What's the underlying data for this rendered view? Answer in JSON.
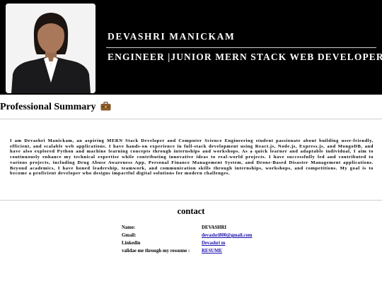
{
  "header": {
    "name": "DEVASHRI MANICKAM",
    "role": "ENGINEER |JUNIOR MERN STACK WEB DEVELOPER"
  },
  "summary": {
    "title": "Professional Summary",
    "icon": "briefcase-icon",
    "text": "I am Devashri Manickam, an aspiring MERN Stack Developer and Computer Science Engineering student passionate about building user-friendly, efficient, and scalable web applications. I have hands-on experience in full-stack development using React.js, Node.js, Express.js, and MongoDB, and have also explored Python and machine learning concepts through internships and workshops. As a quick learner and adaptable individual, I aim to continuously enhance my technical expertise while contributing innovative ideas to real-world projects. I have successfully led and contributed to various projects, including Drug Abuse Awareness App, Personal Finance Management System, and Drone-Based Disaster Management applications. Beyond academics, I have honed leadership, teamwork, and communication skills through internships, workshops, and competitions. My goal is to become a proficient developer who designs impactful digital solutions for modern challenges."
  },
  "contact": {
    "title": "contact",
    "name_label": "Name:",
    "name_value": "DEVASHRI",
    "gmail_label": "Gmail:",
    "gmail_value": "devashri800@gmail.com",
    "linkedin_label": "Linkedin",
    "linkedin_value": "Devashri m",
    "resume_label": "validae me through my ressume :",
    "resume_value": "RESUME"
  },
  "colors": {
    "header_bg": "#000000",
    "link": "#1a0dab",
    "briefcase": "#8a5a2b"
  }
}
